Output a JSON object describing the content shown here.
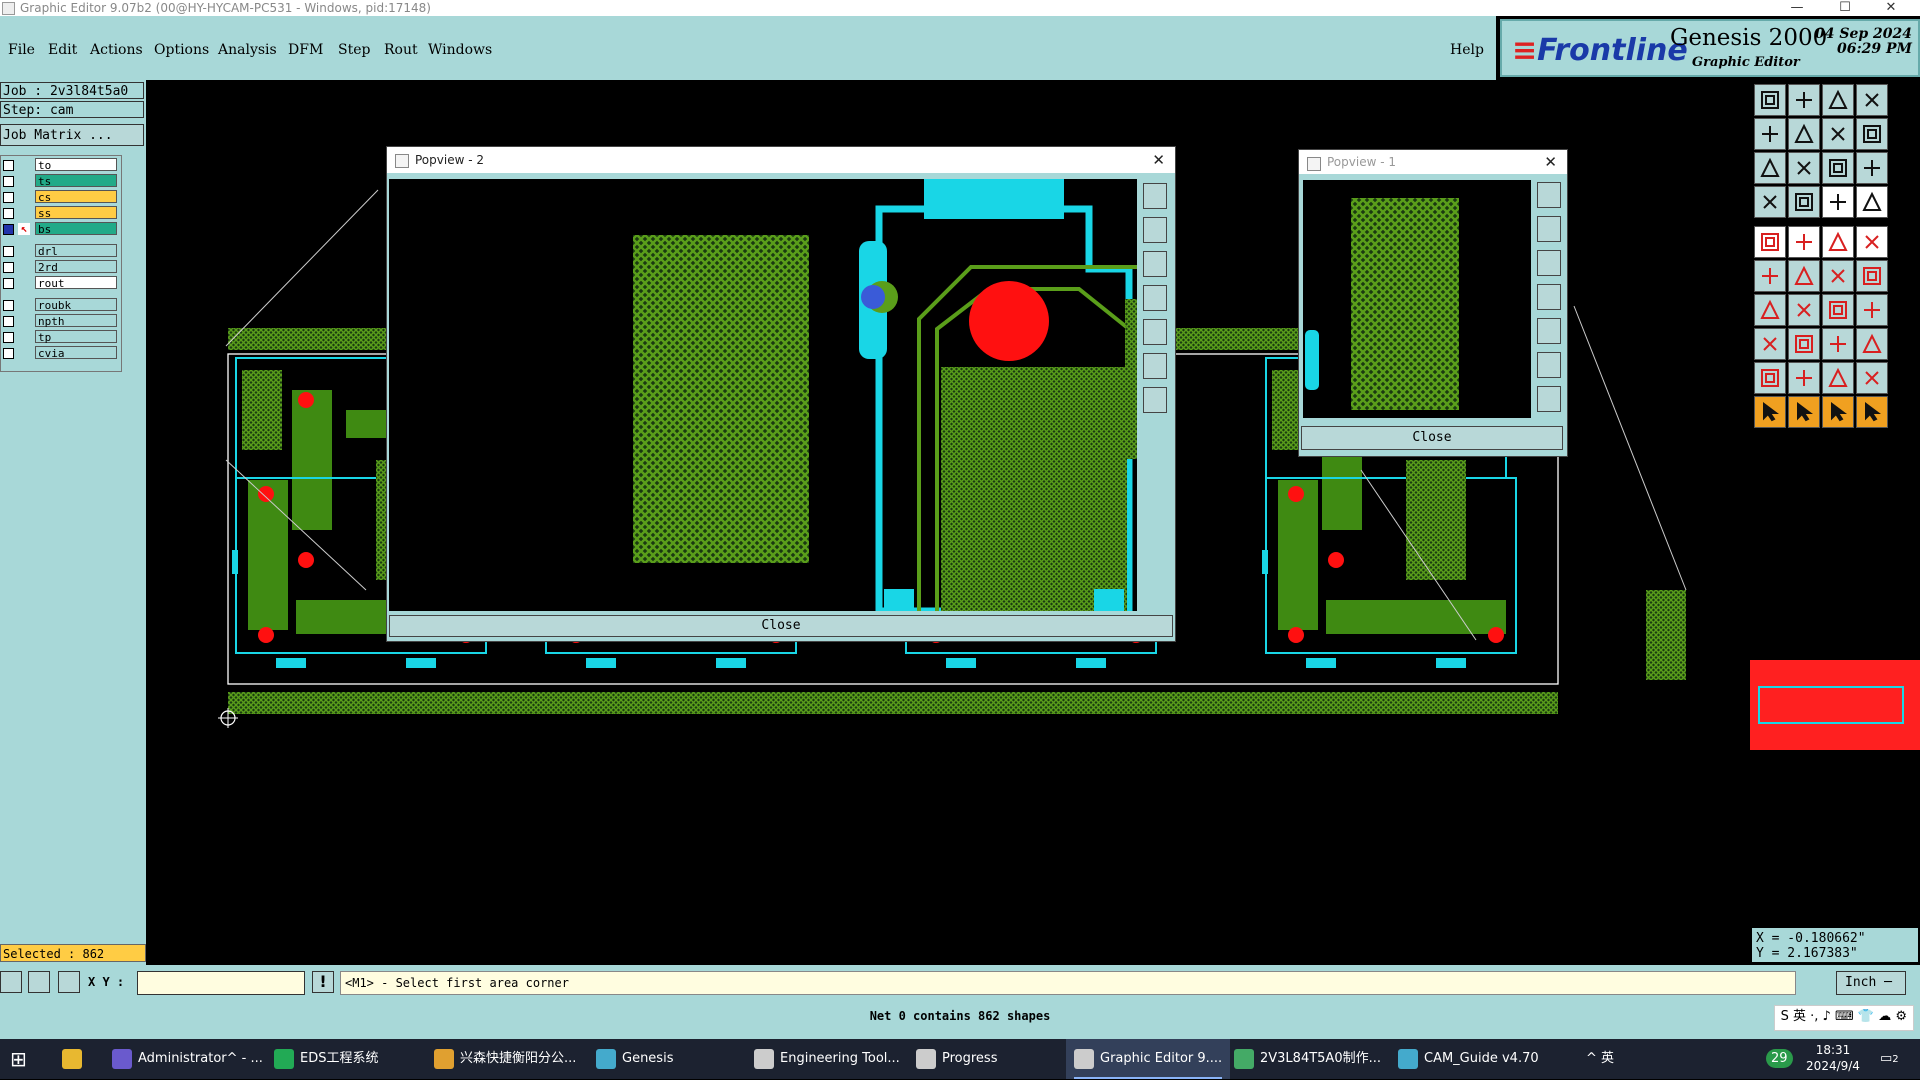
{
  "window": {
    "title": "Graphic Editor 9.07b2 (00@HY-HYCAM-PC531 - Windows, pid:17148)",
    "controls": [
      "—",
      "☐",
      "✕"
    ]
  },
  "menu": [
    "File",
    "Edit",
    "Actions",
    "Options",
    "Analysis",
    "DFM",
    "Step",
    "Rout",
    "Windows"
  ],
  "help": "Help",
  "brand": {
    "logo": "Frontline",
    "product": "Genesis 2000",
    "subtitle": "Graphic Editor",
    "date": "04 Sep 2024",
    "time": "06:29 PM",
    "colors": {
      "logo": "#1a3aa8",
      "accent": "#d22222"
    }
  },
  "left": {
    "job": "Job : 2v3l84t5a0",
    "step": "Step: cam",
    "job_matrix": "Job Matrix ...",
    "layers": [
      {
        "name": "to",
        "color": "#ffffff"
      },
      {
        "name": "ts",
        "color": "#22aa88"
      },
      {
        "name": "cs",
        "color": "#ffcc44"
      },
      {
        "name": "ss",
        "color": "#ffcc44"
      },
      {
        "name": "bs",
        "color": "#22aa88",
        "active": true
      },
      {
        "name": "drl",
        "color": "#a8d8d8"
      },
      {
        "name": "2rd",
        "color": "#a8d8d8"
      },
      {
        "name": "rout",
        "color": "#ffffff"
      },
      {
        "name": "roubk",
        "color": "#a8d8d8"
      },
      {
        "name": "npth",
        "color": "#a8d8d8"
      },
      {
        "name": "tp",
        "color": "#a8d8d8"
      },
      {
        "name": "cvia",
        "color": "#a8d8d8"
      }
    ],
    "selected": "Selected : 862"
  },
  "popview2": {
    "title": "Popview - 2",
    "close": "Close"
  },
  "popview1": {
    "title": "Popview - 1",
    "close": "Close"
  },
  "coords": {
    "x": "X = -0.180662\"",
    "y": "Y = 2.167383\""
  },
  "command": {
    "xy_label": "X Y :",
    "prompt": "<M1> - Select first area corner",
    "units": "Inch ─"
  },
  "status": "Net 0 contains 862 shapes",
  "ime": "S 英 ·, ♪ ⌨ 👕 ☁ ⚙",
  "taskbar": {
    "items": [
      {
        "label": "Administrator^ - ...",
        "color": "#6a5acd"
      },
      {
        "label": "EDS工程系统",
        "color": "#22aa55"
      },
      {
        "label": "兴森快捷衡阳分公...",
        "color": "#e0a030"
      },
      {
        "label": "Genesis",
        "color": "#44aacc"
      },
      {
        "label": "Engineering Tool...",
        "color": "#cccccc"
      },
      {
        "label": "Progress",
        "color": "#cccccc"
      },
      {
        "label": "Graphic Editor 9....",
        "color": "#cccccc",
        "active": true
      },
      {
        "label": "2V3L84T5A0制作...",
        "color": "#44aa66"
      },
      {
        "label": "CAM_Guide v4.70",
        "color": "#44aacc"
      }
    ],
    "tray": "^ 英",
    "badge": "29",
    "time": "18:31",
    "date": "2024/9/4",
    "notifications": "2"
  }
}
